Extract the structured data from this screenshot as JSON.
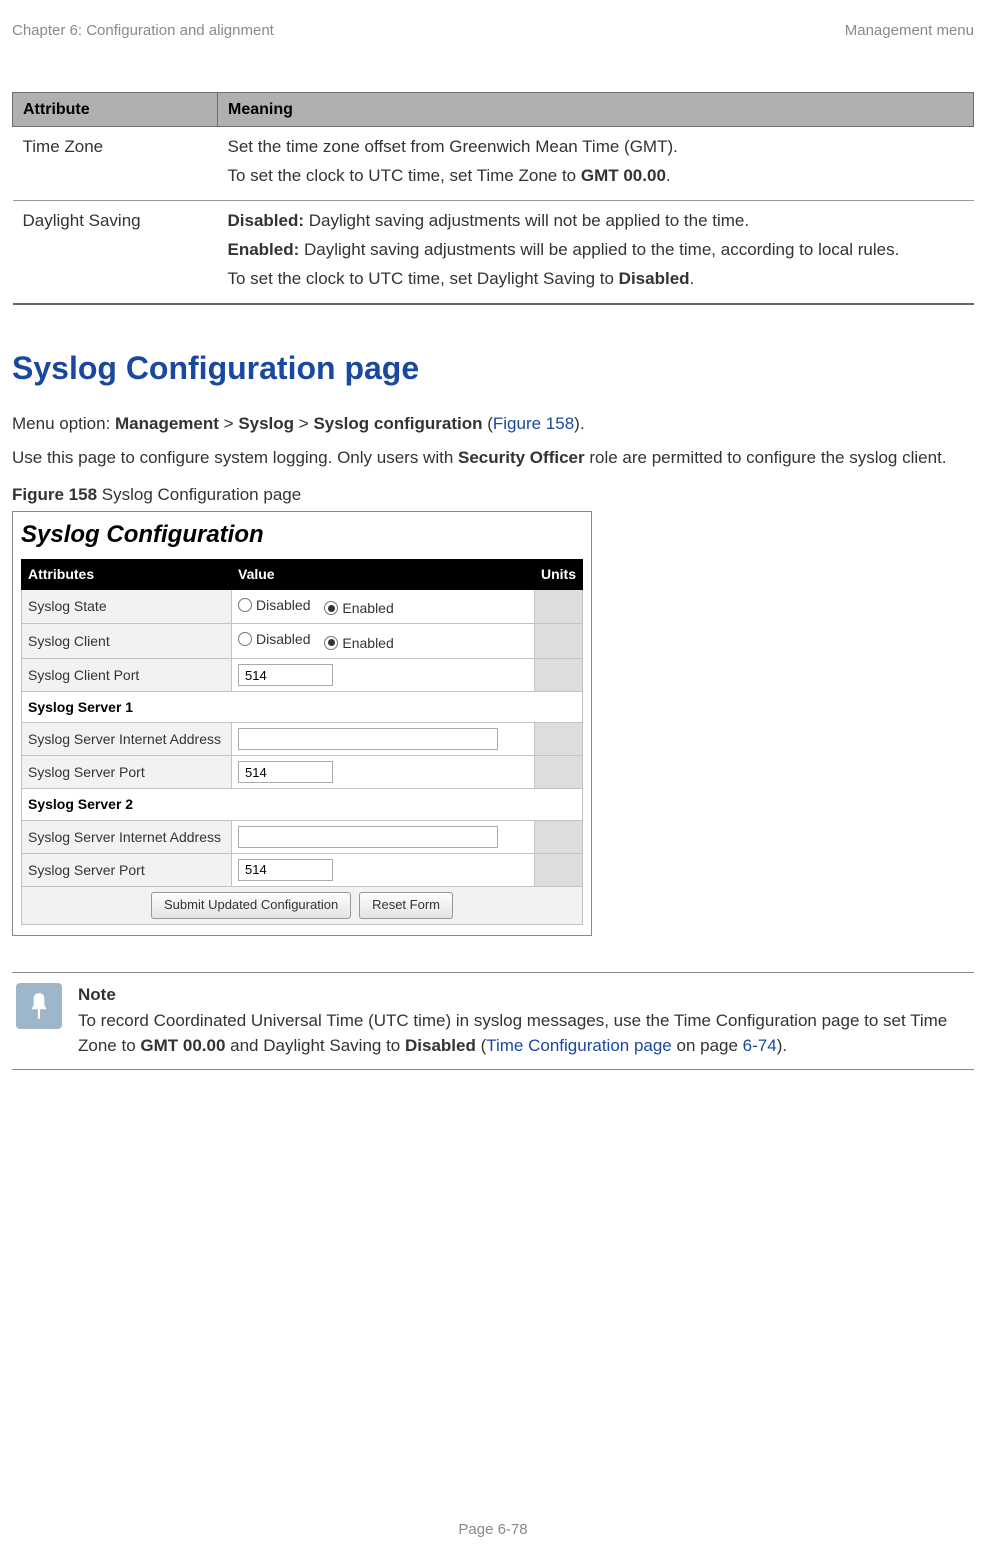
{
  "header": {
    "left": "Chapter 6:  Configuration and alignment",
    "right": "Management menu"
  },
  "attr_table": {
    "headers": [
      "Attribute",
      "Meaning"
    ],
    "rows": [
      {
        "attr": "Time Zone",
        "lines": [
          {
            "text": "Set the time zone offset from Greenwich Mean Time (GMT)."
          },
          {
            "prefix": "To set the clock to UTC time, set Time Zone to ",
            "bold": "GMT 00.00",
            "suffix": "."
          }
        ]
      },
      {
        "attr": "Daylight Saving",
        "lines": [
          {
            "bold_lead": "Disabled:",
            "text": " Daylight saving adjustments will not be applied to the time."
          },
          {
            "bold_lead": "Enabled:",
            "text": " Daylight saving adjustments will be applied to the time, according to local rules."
          },
          {
            "prefix": "To set the clock to UTC time, set Daylight Saving to ",
            "bold": "Disabled",
            "suffix": "."
          }
        ]
      }
    ]
  },
  "section_heading": "Syslog Configuration page",
  "menu_option": {
    "pre": "Menu option: ",
    "b1": "Management",
    "sep1": " > ",
    "b2": "Syslog",
    "sep2": " > ",
    "b3": "Syslog configuration",
    "open": " (",
    "link": "Figure 158",
    "close": ")."
  },
  "usage": {
    "pre": "Use this page to configure system logging. Only users with ",
    "bold": "Security Officer",
    "post": " role are permitted to configure the syslog client."
  },
  "figure_caption": {
    "bold": "Figure 158",
    "rest": "  Syslog Configuration page"
  },
  "figure": {
    "title": "Syslog Configuration",
    "headers": [
      "Attributes",
      "Value",
      "Units"
    ],
    "rows": {
      "state": {
        "label": "Syslog State",
        "opt1": "Disabled",
        "opt2": "Enabled",
        "selected": 2
      },
      "client": {
        "label": "Syslog Client",
        "opt1": "Disabled",
        "opt2": "Enabled",
        "selected": 2
      },
      "client_port": {
        "label": "Syslog Client Port",
        "value": "514"
      },
      "server1": "Syslog Server 1",
      "s1_addr": {
        "label": "Syslog Server Internet Address",
        "value": ""
      },
      "s1_port": {
        "label": "Syslog Server Port",
        "value": "514"
      },
      "server2": "Syslog Server 2",
      "s2_addr": {
        "label": "Syslog Server Internet Address",
        "value": ""
      },
      "s2_port": {
        "label": "Syslog Server Port",
        "value": "514"
      }
    },
    "buttons": {
      "submit": "Submit Updated Configuration",
      "reset": "Reset Form"
    }
  },
  "note": {
    "title": "Note",
    "pre": "To record Coordinated Universal Time (UTC time) in syslog messages, use the Time Configuration page to set Time Zone to ",
    "b1": "GMT 00.00",
    "mid": " and Daylight Saving to ",
    "b2": "Disabled",
    "open": " (",
    "link": "Time Configuration page",
    "mid2": " on page ",
    "page_ref": "6-74",
    "close": ")."
  },
  "footer": "Page 6-78"
}
